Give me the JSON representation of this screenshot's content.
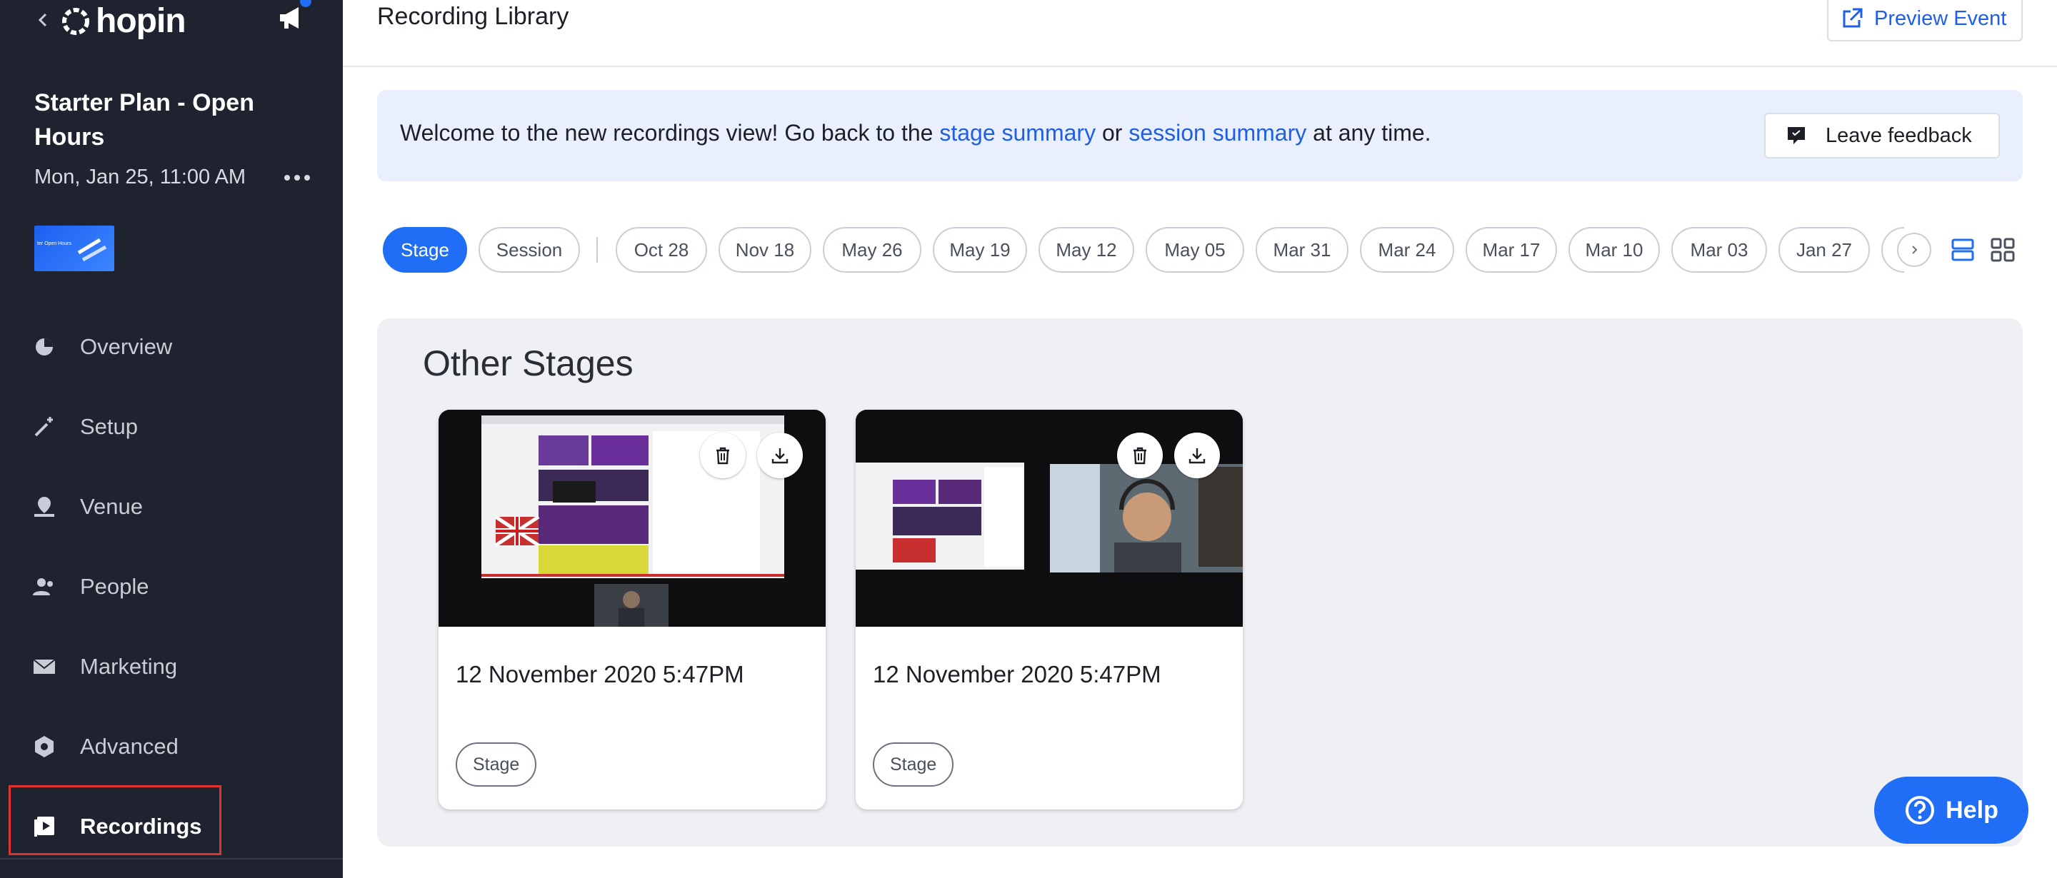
{
  "app": {
    "logo_text": "hopin"
  },
  "sidebar": {
    "event_title": "Starter Plan - Open Hours",
    "event_date": "Mon, Jan 25, 11:00 AM",
    "thumbnail_text": "ter Open Hours",
    "items": [
      {
        "label": "Overview",
        "icon": "pie-chart-icon"
      },
      {
        "label": "Setup",
        "icon": "magic-wand-icon"
      },
      {
        "label": "Venue",
        "icon": "map-pin-icon"
      },
      {
        "label": "People",
        "icon": "people-icon"
      },
      {
        "label": "Marketing",
        "icon": "envelope-icon"
      },
      {
        "label": "Advanced",
        "icon": "hexagon-gear-icon"
      },
      {
        "label": "Recordings",
        "icon": "recording-play-icon",
        "active": true
      }
    ]
  },
  "header": {
    "title": "Recording Library",
    "preview_label": "Preview Event"
  },
  "banner": {
    "text_before": "Welcome to the new recordings view! Go back to the ",
    "link_stage": "stage summary",
    "text_or": " or ",
    "link_session": "session summary",
    "text_after": " at any time.",
    "feedback_label": "Leave feedback"
  },
  "filters": {
    "types": [
      "Stage",
      "Session"
    ],
    "active_type": "Stage",
    "dates": [
      "Oct 28",
      "Nov 18",
      "May 26",
      "May 19",
      "May 12",
      "May 05",
      "Mar 31",
      "Mar 24",
      "Mar 17",
      "Mar 10",
      "Mar 03",
      "Jan 27"
    ]
  },
  "section": {
    "title": "Other Stages",
    "cards": [
      {
        "title": "12 November 2020 5:47PM",
        "tag": "Stage"
      },
      {
        "title": "12 November 2020 5:47PM",
        "tag": "Stage"
      }
    ]
  },
  "help": {
    "label": "Help"
  },
  "colors": {
    "accent": "#1f6ef5",
    "link": "#1f5fe6",
    "sidebar_bg": "#1f2330",
    "highlight": "#e0332d"
  }
}
